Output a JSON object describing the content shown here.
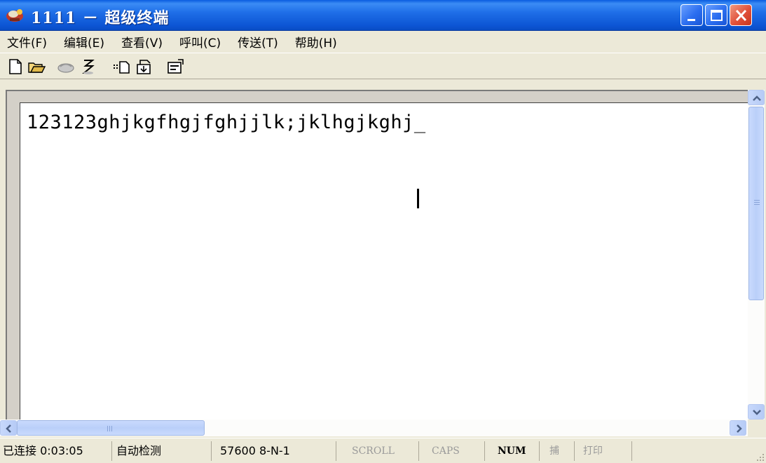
{
  "window": {
    "title": "1111 － 超级终端"
  },
  "menu": {
    "items": [
      {
        "label": "文件(F)"
      },
      {
        "label": "编辑(E)"
      },
      {
        "label": "查看(V)"
      },
      {
        "label": "呼叫(C)"
      },
      {
        "label": "传送(T)"
      },
      {
        "label": "帮助(H)"
      }
    ]
  },
  "toolbar": {
    "icons": [
      "new-connection-icon",
      "open-icon",
      "call-icon",
      "disconnect-icon",
      "send-icon",
      "receive-icon",
      "properties-icon"
    ]
  },
  "terminal": {
    "text": "123123ghjkgfhgjfghjjlk;jklhgjkghj_"
  },
  "status": {
    "connection": "已连接 0:03:05",
    "detect": "自动检测",
    "port_settings": "57600 8-N-1",
    "scroll": "SCROLL",
    "caps": "CAPS",
    "num": "NUM",
    "capture": "捕",
    "print": "打印"
  },
  "colors": {
    "titlebar": "#0a5ce0",
    "close_button": "#e0503a",
    "scrollbar": "#bacff9"
  }
}
